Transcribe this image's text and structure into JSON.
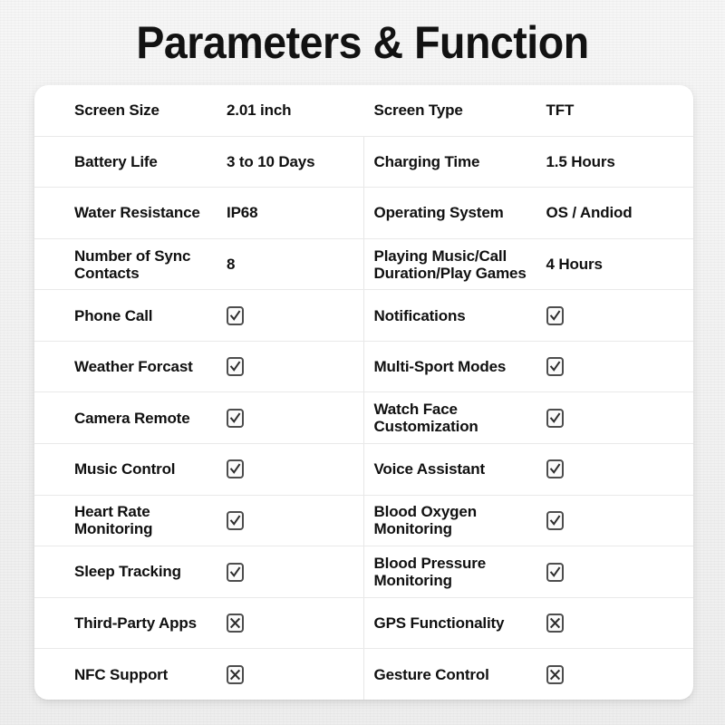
{
  "header": {
    "title": "Parameters & Function"
  },
  "colors": {
    "page_background": "#f2f2f2",
    "card_background": "#ffffff",
    "text": "#101010",
    "divider": "#e9e9e9",
    "mark_border": "#4d4d4d"
  },
  "table": {
    "rows": [
      {
        "left": {
          "label": "Screen Size",
          "value": "2.01 inch",
          "type": "text"
        },
        "right": {
          "label": "Screen Type",
          "value": "TFT",
          "type": "text"
        },
        "divider": false
      },
      {
        "left": {
          "label": "Battery Life",
          "value": "3 to 10 Days",
          "type": "text"
        },
        "right": {
          "label": "Charging Time",
          "value": "1.5 Hours",
          "type": "text"
        },
        "divider": true
      },
      {
        "left": {
          "label": "Water Resistance",
          "value": "IP68",
          "type": "text"
        },
        "right": {
          "label": "Operating System",
          "value": "OS / Andiod",
          "type": "text"
        },
        "divider": true
      },
      {
        "left": {
          "label": "Number of Sync Contacts",
          "value": "8",
          "type": "text"
        },
        "right": {
          "label": "Playing Music/Call Duration/Play Games",
          "value": "4 Hours",
          "type": "text"
        },
        "divider": true
      },
      {
        "left": {
          "label": "Phone Call",
          "value": "check-icon",
          "type": "mark"
        },
        "right": {
          "label": "Notifications",
          "value": "check-icon",
          "type": "mark"
        },
        "divider": true
      },
      {
        "left": {
          "label": "Weather Forcast",
          "value": "check-icon",
          "type": "mark"
        },
        "right": {
          "label": "Multi-Sport Modes",
          "value": "check-icon",
          "type": "mark"
        },
        "divider": true
      },
      {
        "left": {
          "label": "Camera Remote",
          "value": "check-icon",
          "type": "mark"
        },
        "right": {
          "label": "Watch Face Customization",
          "value": "check-icon",
          "type": "mark"
        },
        "divider": true
      },
      {
        "left": {
          "label": "Music Control",
          "value": "check-icon",
          "type": "mark"
        },
        "right": {
          "label": "Voice Assistant",
          "value": "check-icon",
          "type": "mark"
        },
        "divider": true
      },
      {
        "left": {
          "label": "Heart Rate Monitoring",
          "value": "check-icon",
          "type": "mark"
        },
        "right": {
          "label": "Blood Oxygen Monitoring",
          "value": "check-icon",
          "type": "mark"
        },
        "divider": true
      },
      {
        "left": {
          "label": "Sleep Tracking",
          "value": "check-icon",
          "type": "mark"
        },
        "right": {
          "label": "Blood Pressure Monitoring",
          "value": "check-icon",
          "type": "mark"
        },
        "divider": true
      },
      {
        "left": {
          "label": "Third-Party Apps",
          "value": "cross-icon",
          "type": "mark"
        },
        "right": {
          "label": "GPS Functionality",
          "value": "cross-icon",
          "type": "mark"
        },
        "divider": true
      },
      {
        "left": {
          "label": "NFC Support",
          "value": "cross-icon",
          "type": "mark"
        },
        "right": {
          "label": "Gesture Control",
          "value": "cross-icon",
          "type": "mark"
        },
        "divider": true
      }
    ]
  }
}
